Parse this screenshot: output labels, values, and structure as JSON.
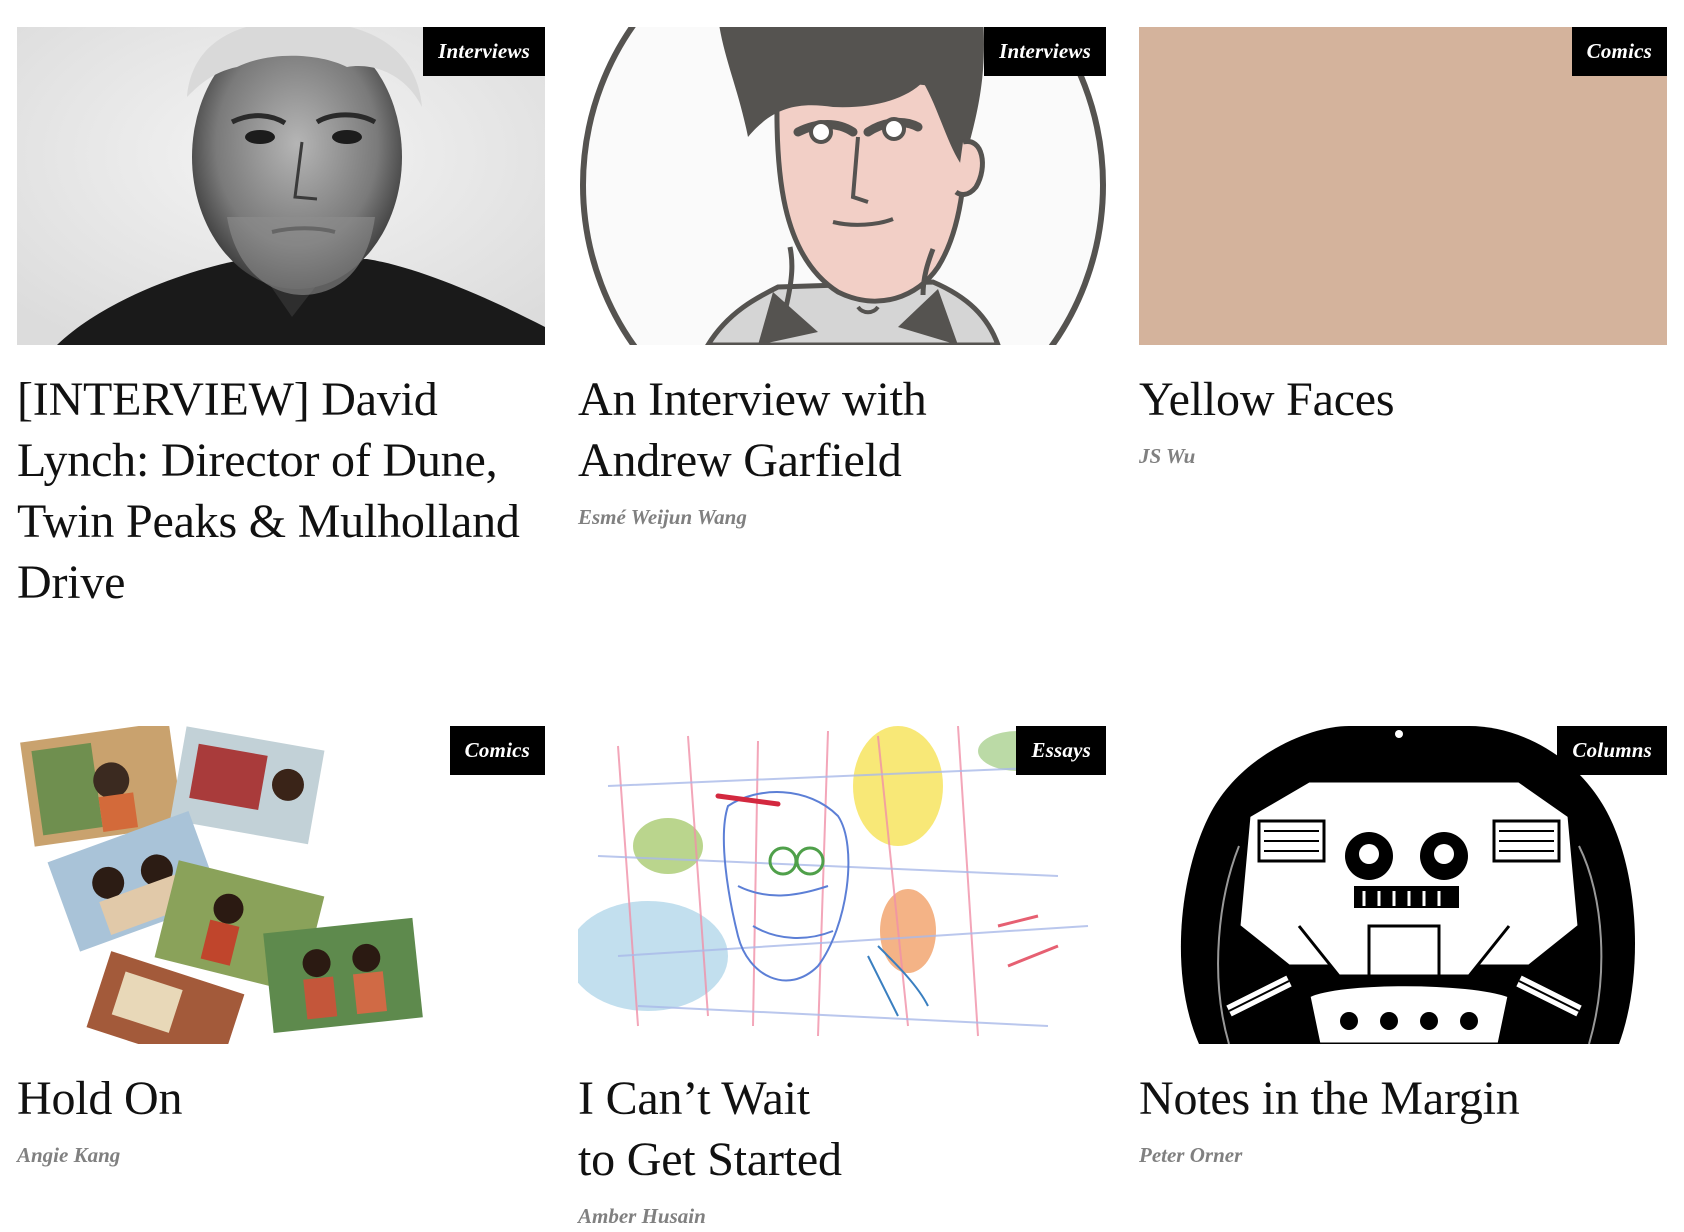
{
  "articles": [
    {
      "category": "Interviews",
      "title": "[INTERVIEW] David Lynch: Director of Dune, Twin Peaks & Mulholland Drive",
      "author": "",
      "image": "black-and-white-portrait-photo"
    },
    {
      "category": "Interviews",
      "title_line1": "An Interview with",
      "title_line2": "Andrew Garfield",
      "author": "Esmé Weijun Wang",
      "image": "cartoon-portrait-illustration"
    },
    {
      "category": "Comics",
      "title": "Yellow Faces",
      "author": "JS Wu",
      "image": "solid-tan-color-block",
      "image_color": "#d4b39c"
    },
    {
      "category": "Comics",
      "title": "Hold On",
      "author": "Angie Kang",
      "image": "torn-watercolor-photos-illustration"
    },
    {
      "category": "Essays",
      "title_line1": "I Can’t Wait",
      "title_line2": "to Get Started",
      "author": "Amber Husain",
      "image": "colored-pencil-sketch"
    },
    {
      "category": "Columns",
      "title": "Notes in the Margin",
      "author": "Peter Orner",
      "image": "black-and-white-ink-robot-illustration"
    }
  ],
  "colors": {
    "badge_bg": "#000000",
    "badge_text": "#ffffff",
    "title_text": "#111111",
    "author_text": "#808080"
  }
}
